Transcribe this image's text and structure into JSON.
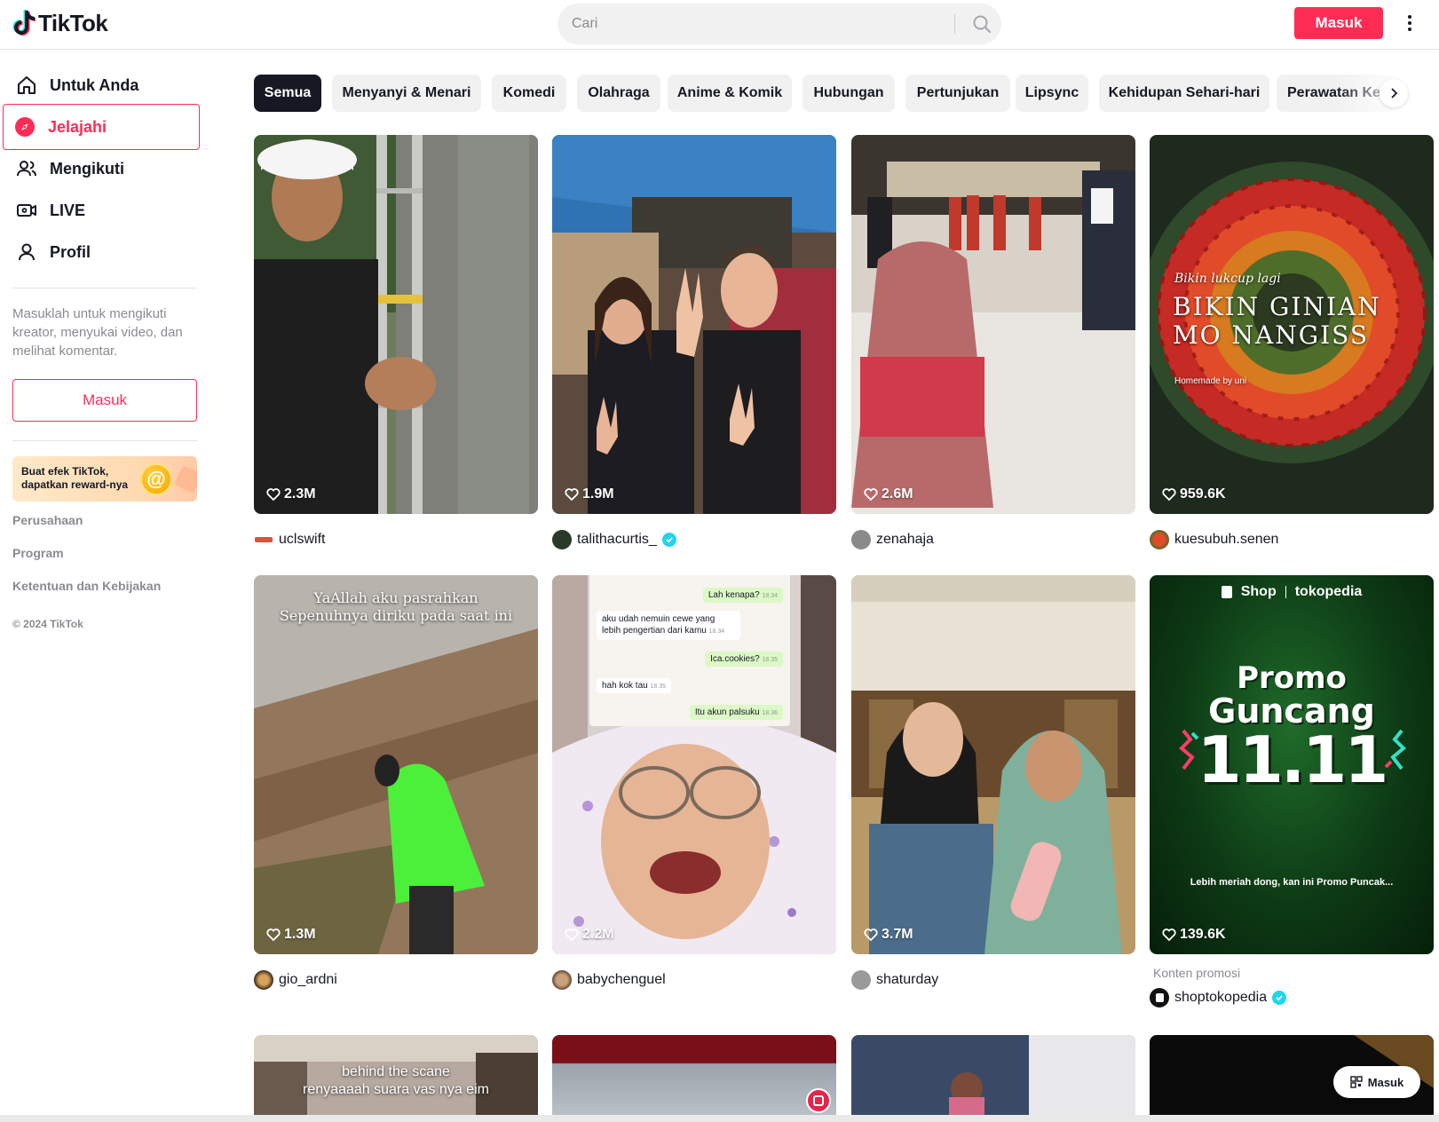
{
  "brand": {
    "name": "TikTok",
    "accent": "#fe2c55"
  },
  "header": {
    "search_placeholder": "Cari",
    "login_label": "Masuk",
    "icons": {
      "search": "search-icon",
      "more": "more-vertical-icon"
    }
  },
  "sidebar": {
    "nav": [
      {
        "label": "Untuk Anda",
        "icon": "home-icon"
      },
      {
        "label": "Jelajahi",
        "icon": "compass-icon",
        "active": true
      },
      {
        "label": "Mengikuti",
        "icon": "following-icon"
      },
      {
        "label": "LIVE",
        "icon": "live-icon"
      },
      {
        "label": "Profil",
        "icon": "profile-icon"
      }
    ],
    "login_prompt": "Masuklah untuk mengikuti kreator, menyukai video, dan melihat komentar.",
    "login_button": "Masuk",
    "effect_banner": {
      "line1": "Buat efek TikTok,",
      "line2": "dapatkan reward-nya"
    },
    "footer": {
      "company": "Perusahaan",
      "program": "Program",
      "terms": "Ketentuan dan Kebijakan",
      "copyright": "© 2024 TikTok"
    }
  },
  "categories": [
    "Semua",
    "Menyanyi & Menari",
    "Komedi",
    "Olahraga",
    "Anime & Komik",
    "Hubungan",
    "Pertunjukan",
    "Lipsync",
    "Kehidupan Sehari-hari",
    "Perawatan Ke"
  ],
  "videos": [
    {
      "likes": "2.3M",
      "author": "uclswift",
      "verified": false
    },
    {
      "likes": "1.9M",
      "author": "talithacurtis_",
      "verified": true
    },
    {
      "likes": "2.6M",
      "author": "zenahaja",
      "verified": false
    },
    {
      "likes": "959.6K",
      "author": "kuesubuh.senen",
      "verified": false,
      "overlay": {
        "script": "Bikin lukcup lagi",
        "title1": "BIKIN GINIAN",
        "title2": "MO NANGISS",
        "credit": "Homemade by uni"
      }
    },
    {
      "likes": "1.3M",
      "author": "gio_ardni",
      "verified": false,
      "overlay": {
        "line1": "YaAllah aku pasrahkan",
        "line2": "Sepenuhnya diriku pada saat ini"
      }
    },
    {
      "likes": "2.2M",
      "author": "babychenguel",
      "verified": false,
      "chat": [
        {
          "text": "Lah kenapa?",
          "time": "18.34",
          "out": true
        },
        {
          "text": "aku udah nemuin cewe yang lebih pengertian dari kamu",
          "time": "18.34",
          "out": false
        },
        {
          "text": "Ica.cookies?",
          "time": "18.35",
          "out": true
        },
        {
          "text": "hah kok tau",
          "time": "18.35",
          "out": false
        },
        {
          "text": "Itu akun palsuku",
          "time": "18.36",
          "out": true
        }
      ]
    },
    {
      "likes": "3.7M",
      "author": "shaturday",
      "verified": false
    },
    {
      "likes": "139.6K",
      "author": "shoptokopedia",
      "verified": true,
      "promo_label": "Konten promosi",
      "overlay": {
        "shop": "Shop",
        "tokopedia": "tokopedia",
        "promo": "Promo",
        "guncang": "Guncang",
        "date": "11.11",
        "caption": "Lebih meriah dong, kan ini Promo Puncak..."
      }
    },
    {
      "overlay": {
        "line1": "behind the scane",
        "line2": "renyaaaah suara vas nya eim"
      }
    },
    {},
    {},
    {}
  ],
  "floating_login": "Masuk"
}
